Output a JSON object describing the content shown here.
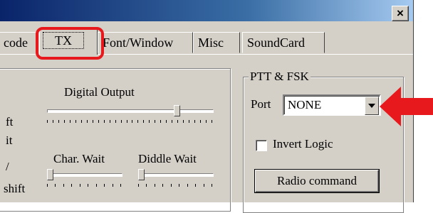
{
  "titlebar": {
    "close_label": "×"
  },
  "tabs": [
    {
      "label": "code"
    },
    {
      "label": "TX"
    },
    {
      "label": "Font/Window"
    },
    {
      "label": "Misc"
    },
    {
      "label": "SoundCard"
    }
  ],
  "tx_group": {
    "digital_output_label": "Digital Output",
    "char_wait_label": "Char. Wait",
    "diddle_wait_label": "Diddle Wait",
    "left_label_1": "ft",
    "left_label_2": "it",
    "left_label_3": "/",
    "left_label_4": "shift",
    "digital_output_value": 0.8,
    "char_wait_value": 0.0,
    "diddle_wait_value": 0.0
  },
  "ptt_group": {
    "title": "PTT & FSK",
    "port_label": "Port",
    "port_value": "NONE",
    "invert_logic_label": "Invert Logic",
    "invert_logic_checked": false,
    "radio_command_label": "Radio command"
  },
  "annotations": {
    "highlight_color": "#e8191c",
    "arrow_color": "#e8191c"
  }
}
